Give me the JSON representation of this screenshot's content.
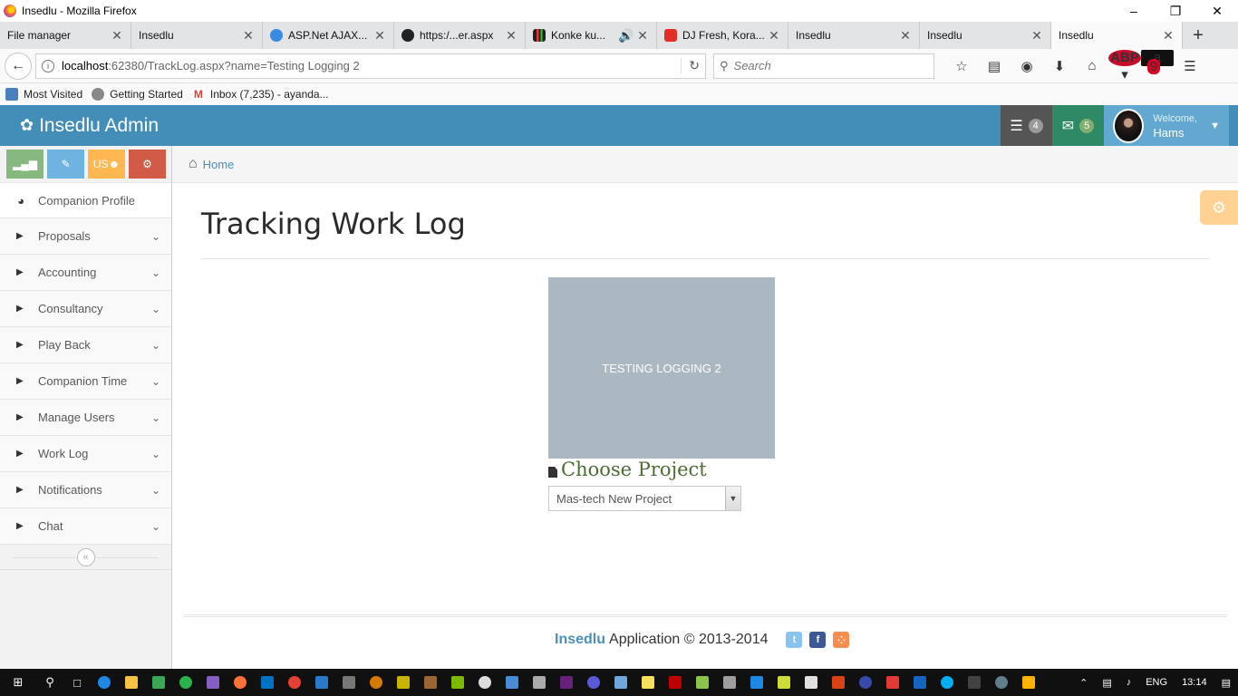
{
  "window": {
    "title": "Insedlu - Mozilla Firefox"
  },
  "tabs": [
    {
      "label": "File manager",
      "icon": "none",
      "color": ""
    },
    {
      "label": "Insedlu",
      "icon": "none",
      "color": ""
    },
    {
      "label": "ASP.Net AJAX...",
      "icon": "asp-icon",
      "color": "#3a8be0"
    },
    {
      "label": "https:/...er.aspx",
      "icon": "tc-icon",
      "color": "#222"
    },
    {
      "label": "Konke ku...",
      "icon": "chart-icon",
      "color": "#222"
    },
    {
      "label": "DJ Fresh, Kora...",
      "icon": "youtube-icon",
      "color": "#e52d27"
    },
    {
      "label": "Insedlu",
      "icon": "none",
      "color": ""
    },
    {
      "label": "Insedlu",
      "icon": "none",
      "color": ""
    },
    {
      "label": "Insedlu",
      "icon": "none",
      "color": "",
      "active": true
    }
  ],
  "nav": {
    "url_host": "localhost",
    "url_rest": ":62380/TrackLog.aspx?name=Testing Logging 2",
    "search_placeholder": "Search",
    "notification_count": "9"
  },
  "bookmarks": [
    {
      "label": "Most Visited",
      "color": "#4a7fc1"
    },
    {
      "label": "Getting Started",
      "color": "#888"
    },
    {
      "label": "Inbox (7,235) - ayanda...",
      "color": "#d44638"
    }
  ],
  "header": {
    "brand": "Insedlu Admin",
    "tasks_count": "4",
    "messages_count": "5",
    "welcome": "Welcome,",
    "user_name": "Hams"
  },
  "shortcuts": {
    "orange_label": "US"
  },
  "sidebar": {
    "items": [
      {
        "label": "Companion Profile",
        "type": "dashboard"
      },
      {
        "label": "Proposals"
      },
      {
        "label": "Accounting"
      },
      {
        "label": "Consultancy"
      },
      {
        "label": "Play Back"
      },
      {
        "label": "Companion Time"
      },
      {
        "label": "Manage Users"
      },
      {
        "label": "Work Log"
      },
      {
        "label": "Notifications"
      },
      {
        "label": "Chat"
      }
    ]
  },
  "breadcrumb": {
    "home": "Home"
  },
  "main": {
    "title": "Tracking Work Log",
    "tile_label": "Testing Logging 2",
    "choose_label": "Choose Project",
    "selected_project": "Mas-tech New Project"
  },
  "footer": {
    "brand": "Insedlu",
    "text": "Application © 2013-2014"
  },
  "taskbar": {
    "language": "ENG",
    "time": "13:14"
  },
  "colors": {
    "header_blue": "#438eb9",
    "tile_grey": "#abb7c1",
    "link_blue": "#4c8fbd"
  }
}
